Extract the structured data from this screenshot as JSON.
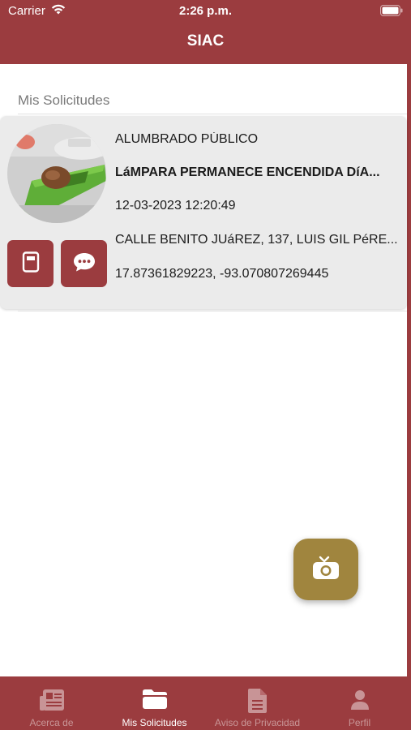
{
  "status_bar": {
    "carrier": "Carrier",
    "time": "2:26 p.m.",
    "icons": [
      "wifi-icon",
      "battery-icon"
    ]
  },
  "header": {
    "title": "SIAC"
  },
  "main": {
    "section_title": "Mis Solicitudes",
    "requests": [
      {
        "category": "ALUMBRADO PÚBLICO",
        "title": "LáMPARA PERMANECE ENCENDIDA DíA...",
        "datetime": "12-03-2023 12:20:49",
        "address": "CALLE BENITO JUáREZ, 137, LUIS GIL PéRE...",
        "coordinates": "17.87361829223, -93.070807269445",
        "buttons": [
          "detail-icon",
          "comment-icon"
        ]
      }
    ]
  },
  "fab": {
    "icon": "camera-icon"
  },
  "tabbar": {
    "active_index": 1,
    "tabs": [
      {
        "label": "Acerca de",
        "icon": "newspaper-icon"
      },
      {
        "label": "Mis Solicitudes",
        "icon": "folder-icon"
      },
      {
        "label": "Aviso de Privacidad",
        "icon": "document-icon"
      },
      {
        "label": "Perfil",
        "icon": "person-icon"
      }
    ]
  },
  "colors": {
    "primary": "#9b3c3f",
    "fab": "#a0853e",
    "card": "#ebebeb",
    "section_title": "#7a7a7a"
  }
}
